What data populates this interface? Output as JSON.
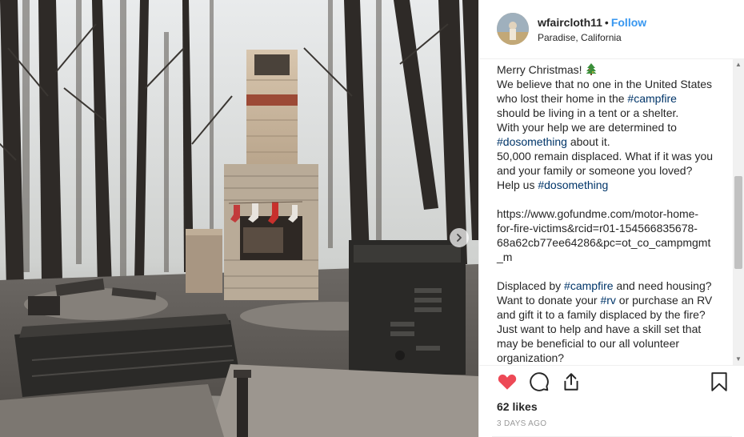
{
  "post": {
    "username": "wfaircloth11",
    "separator": "•",
    "follow_label": "Follow",
    "location": "Paradise, California",
    "caption": [
      {
        "parts": [
          {
            "t": "Merry Christmas!"
          }
        ],
        "tree": true
      },
      {
        "parts": [
          {
            "t": "We believe that no one in the United States"
          }
        ]
      },
      {
        "parts": [
          {
            "t": "who lost their home in the "
          },
          {
            "t": "#campfire",
            "tag": true
          }
        ]
      },
      {
        "parts": [
          {
            "t": "should be living in a tent or a shelter."
          }
        ]
      },
      {
        "parts": [
          {
            "t": "With your help we are determined to"
          }
        ]
      },
      {
        "parts": [
          {
            "t": "#dosomething",
            "tag": true
          },
          {
            "t": " about it."
          }
        ]
      },
      {
        "parts": [
          {
            "t": "50,000 remain displaced. What if it was you"
          }
        ]
      },
      {
        "parts": [
          {
            "t": "and your family or someone you loved?"
          }
        ]
      },
      {
        "parts": [
          {
            "t": "Help us "
          },
          {
            "t": "#dosomething",
            "tag": true
          }
        ]
      },
      {
        "gap": true
      },
      {
        "parts": [
          {
            "t": "https://www.gofundme.com/motor-home-"
          }
        ]
      },
      {
        "parts": [
          {
            "t": "for-fire-victims&rcid=r01-154566835678-"
          }
        ]
      },
      {
        "parts": [
          {
            "t": "68a62cb77ee64286&pc=ot_co_campmgmt"
          }
        ]
      },
      {
        "parts": [
          {
            "t": "_m"
          }
        ]
      },
      {
        "gap": true
      },
      {
        "parts": [
          {
            "t": "Displaced by "
          },
          {
            "t": "#campfire",
            "tag": true
          },
          {
            "t": " and need housing?"
          }
        ]
      },
      {
        "parts": [
          {
            "t": "Want to donate your "
          },
          {
            "t": "#rv",
            "tag": true
          },
          {
            "t": " or purchase an RV"
          }
        ]
      },
      {
        "parts": [
          {
            "t": "and gift it to a family displaced by the fire?"
          }
        ]
      },
      {
        "parts": [
          {
            "t": "Just want to help and have a skill set that"
          }
        ]
      },
      {
        "parts": [
          {
            "t": "may be beneficial to our all volunteer"
          }
        ]
      },
      {
        "parts": [
          {
            "t": "organization?"
          }
        ]
      }
    ],
    "likes": "62 likes",
    "time_ago": "3 DAYS AGO"
  },
  "icons": {
    "like": "heart-icon",
    "comment": "comment-icon",
    "share": "share-icon",
    "save": "bookmark-icon",
    "next": "chevron-right-icon",
    "tree": "christmas-tree-emoji"
  },
  "colors": {
    "accent": "#3897f0",
    "hashtag": "#003569",
    "liked_heart": "#ed4956",
    "muted": "#999999"
  }
}
